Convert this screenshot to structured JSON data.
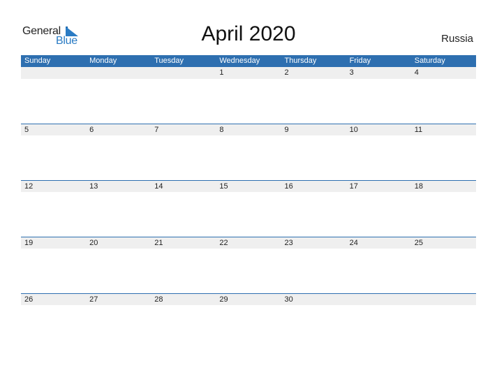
{
  "logo": {
    "text_general": "General",
    "text_blue": "Blue"
  },
  "header": {
    "title": "April 2020",
    "country": "Russia"
  },
  "colors": {
    "accent": "#2e6fb0",
    "strip": "#efefef",
    "logo_blue": "#2a7bc4"
  },
  "calendar": {
    "day_names": [
      "Sunday",
      "Monday",
      "Tuesday",
      "Wednesday",
      "Thursday",
      "Friday",
      "Saturday"
    ],
    "weeks": [
      [
        "",
        "",
        "",
        "1",
        "2",
        "3",
        "4"
      ],
      [
        "5",
        "6",
        "7",
        "8",
        "9",
        "10",
        "11"
      ],
      [
        "12",
        "13",
        "14",
        "15",
        "16",
        "17",
        "18"
      ],
      [
        "19",
        "20",
        "21",
        "22",
        "23",
        "24",
        "25"
      ],
      [
        "26",
        "27",
        "28",
        "29",
        "30",
        "",
        ""
      ]
    ]
  }
}
